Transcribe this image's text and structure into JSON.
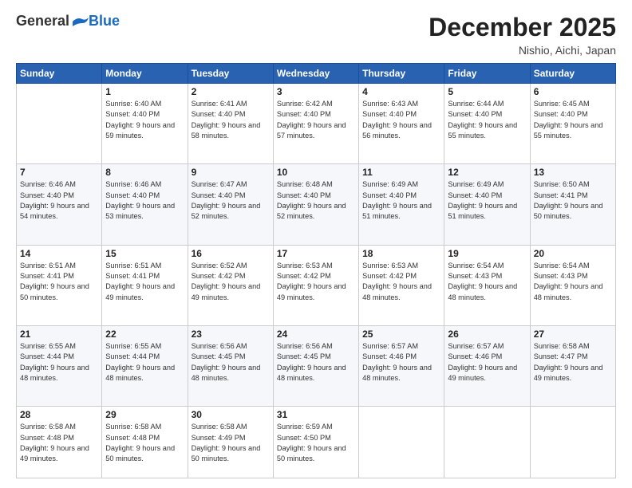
{
  "header": {
    "logo_general": "General",
    "logo_blue": "Blue",
    "month_title": "December 2025",
    "location": "Nishio, Aichi, Japan"
  },
  "days_of_week": [
    "Sunday",
    "Monday",
    "Tuesday",
    "Wednesday",
    "Thursday",
    "Friday",
    "Saturday"
  ],
  "weeks": [
    [
      {
        "day": "",
        "sunrise": "",
        "sunset": "",
        "daylight": ""
      },
      {
        "day": "1",
        "sunrise": "Sunrise: 6:40 AM",
        "sunset": "Sunset: 4:40 PM",
        "daylight": "Daylight: 9 hours and 59 minutes."
      },
      {
        "day": "2",
        "sunrise": "Sunrise: 6:41 AM",
        "sunset": "Sunset: 4:40 PM",
        "daylight": "Daylight: 9 hours and 58 minutes."
      },
      {
        "day": "3",
        "sunrise": "Sunrise: 6:42 AM",
        "sunset": "Sunset: 4:40 PM",
        "daylight": "Daylight: 9 hours and 57 minutes."
      },
      {
        "day": "4",
        "sunrise": "Sunrise: 6:43 AM",
        "sunset": "Sunset: 4:40 PM",
        "daylight": "Daylight: 9 hours and 56 minutes."
      },
      {
        "day": "5",
        "sunrise": "Sunrise: 6:44 AM",
        "sunset": "Sunset: 4:40 PM",
        "daylight": "Daylight: 9 hours and 55 minutes."
      },
      {
        "day": "6",
        "sunrise": "Sunrise: 6:45 AM",
        "sunset": "Sunset: 4:40 PM",
        "daylight": "Daylight: 9 hours and 55 minutes."
      }
    ],
    [
      {
        "day": "7",
        "sunrise": "Sunrise: 6:46 AM",
        "sunset": "Sunset: 4:40 PM",
        "daylight": "Daylight: 9 hours and 54 minutes."
      },
      {
        "day": "8",
        "sunrise": "Sunrise: 6:46 AM",
        "sunset": "Sunset: 4:40 PM",
        "daylight": "Daylight: 9 hours and 53 minutes."
      },
      {
        "day": "9",
        "sunrise": "Sunrise: 6:47 AM",
        "sunset": "Sunset: 4:40 PM",
        "daylight": "Daylight: 9 hours and 52 minutes."
      },
      {
        "day": "10",
        "sunrise": "Sunrise: 6:48 AM",
        "sunset": "Sunset: 4:40 PM",
        "daylight": "Daylight: 9 hours and 52 minutes."
      },
      {
        "day": "11",
        "sunrise": "Sunrise: 6:49 AM",
        "sunset": "Sunset: 4:40 PM",
        "daylight": "Daylight: 9 hours and 51 minutes."
      },
      {
        "day": "12",
        "sunrise": "Sunrise: 6:49 AM",
        "sunset": "Sunset: 4:40 PM",
        "daylight": "Daylight: 9 hours and 51 minutes."
      },
      {
        "day": "13",
        "sunrise": "Sunrise: 6:50 AM",
        "sunset": "Sunset: 4:41 PM",
        "daylight": "Daylight: 9 hours and 50 minutes."
      }
    ],
    [
      {
        "day": "14",
        "sunrise": "Sunrise: 6:51 AM",
        "sunset": "Sunset: 4:41 PM",
        "daylight": "Daylight: 9 hours and 50 minutes."
      },
      {
        "day": "15",
        "sunrise": "Sunrise: 6:51 AM",
        "sunset": "Sunset: 4:41 PM",
        "daylight": "Daylight: 9 hours and 49 minutes."
      },
      {
        "day": "16",
        "sunrise": "Sunrise: 6:52 AM",
        "sunset": "Sunset: 4:42 PM",
        "daylight": "Daylight: 9 hours and 49 minutes."
      },
      {
        "day": "17",
        "sunrise": "Sunrise: 6:53 AM",
        "sunset": "Sunset: 4:42 PM",
        "daylight": "Daylight: 9 hours and 49 minutes."
      },
      {
        "day": "18",
        "sunrise": "Sunrise: 6:53 AM",
        "sunset": "Sunset: 4:42 PM",
        "daylight": "Daylight: 9 hours and 48 minutes."
      },
      {
        "day": "19",
        "sunrise": "Sunrise: 6:54 AM",
        "sunset": "Sunset: 4:43 PM",
        "daylight": "Daylight: 9 hours and 48 minutes."
      },
      {
        "day": "20",
        "sunrise": "Sunrise: 6:54 AM",
        "sunset": "Sunset: 4:43 PM",
        "daylight": "Daylight: 9 hours and 48 minutes."
      }
    ],
    [
      {
        "day": "21",
        "sunrise": "Sunrise: 6:55 AM",
        "sunset": "Sunset: 4:44 PM",
        "daylight": "Daylight: 9 hours and 48 minutes."
      },
      {
        "day": "22",
        "sunrise": "Sunrise: 6:55 AM",
        "sunset": "Sunset: 4:44 PM",
        "daylight": "Daylight: 9 hours and 48 minutes."
      },
      {
        "day": "23",
        "sunrise": "Sunrise: 6:56 AM",
        "sunset": "Sunset: 4:45 PM",
        "daylight": "Daylight: 9 hours and 48 minutes."
      },
      {
        "day": "24",
        "sunrise": "Sunrise: 6:56 AM",
        "sunset": "Sunset: 4:45 PM",
        "daylight": "Daylight: 9 hours and 48 minutes."
      },
      {
        "day": "25",
        "sunrise": "Sunrise: 6:57 AM",
        "sunset": "Sunset: 4:46 PM",
        "daylight": "Daylight: 9 hours and 48 minutes."
      },
      {
        "day": "26",
        "sunrise": "Sunrise: 6:57 AM",
        "sunset": "Sunset: 4:46 PM",
        "daylight": "Daylight: 9 hours and 49 minutes."
      },
      {
        "day": "27",
        "sunrise": "Sunrise: 6:58 AM",
        "sunset": "Sunset: 4:47 PM",
        "daylight": "Daylight: 9 hours and 49 minutes."
      }
    ],
    [
      {
        "day": "28",
        "sunrise": "Sunrise: 6:58 AM",
        "sunset": "Sunset: 4:48 PM",
        "daylight": "Daylight: 9 hours and 49 minutes."
      },
      {
        "day": "29",
        "sunrise": "Sunrise: 6:58 AM",
        "sunset": "Sunset: 4:48 PM",
        "daylight": "Daylight: 9 hours and 50 minutes."
      },
      {
        "day": "30",
        "sunrise": "Sunrise: 6:58 AM",
        "sunset": "Sunset: 4:49 PM",
        "daylight": "Daylight: 9 hours and 50 minutes."
      },
      {
        "day": "31",
        "sunrise": "Sunrise: 6:59 AM",
        "sunset": "Sunset: 4:50 PM",
        "daylight": "Daylight: 9 hours and 50 minutes."
      },
      {
        "day": "",
        "sunrise": "",
        "sunset": "",
        "daylight": ""
      },
      {
        "day": "",
        "sunrise": "",
        "sunset": "",
        "daylight": ""
      },
      {
        "day": "",
        "sunrise": "",
        "sunset": "",
        "daylight": ""
      }
    ]
  ]
}
